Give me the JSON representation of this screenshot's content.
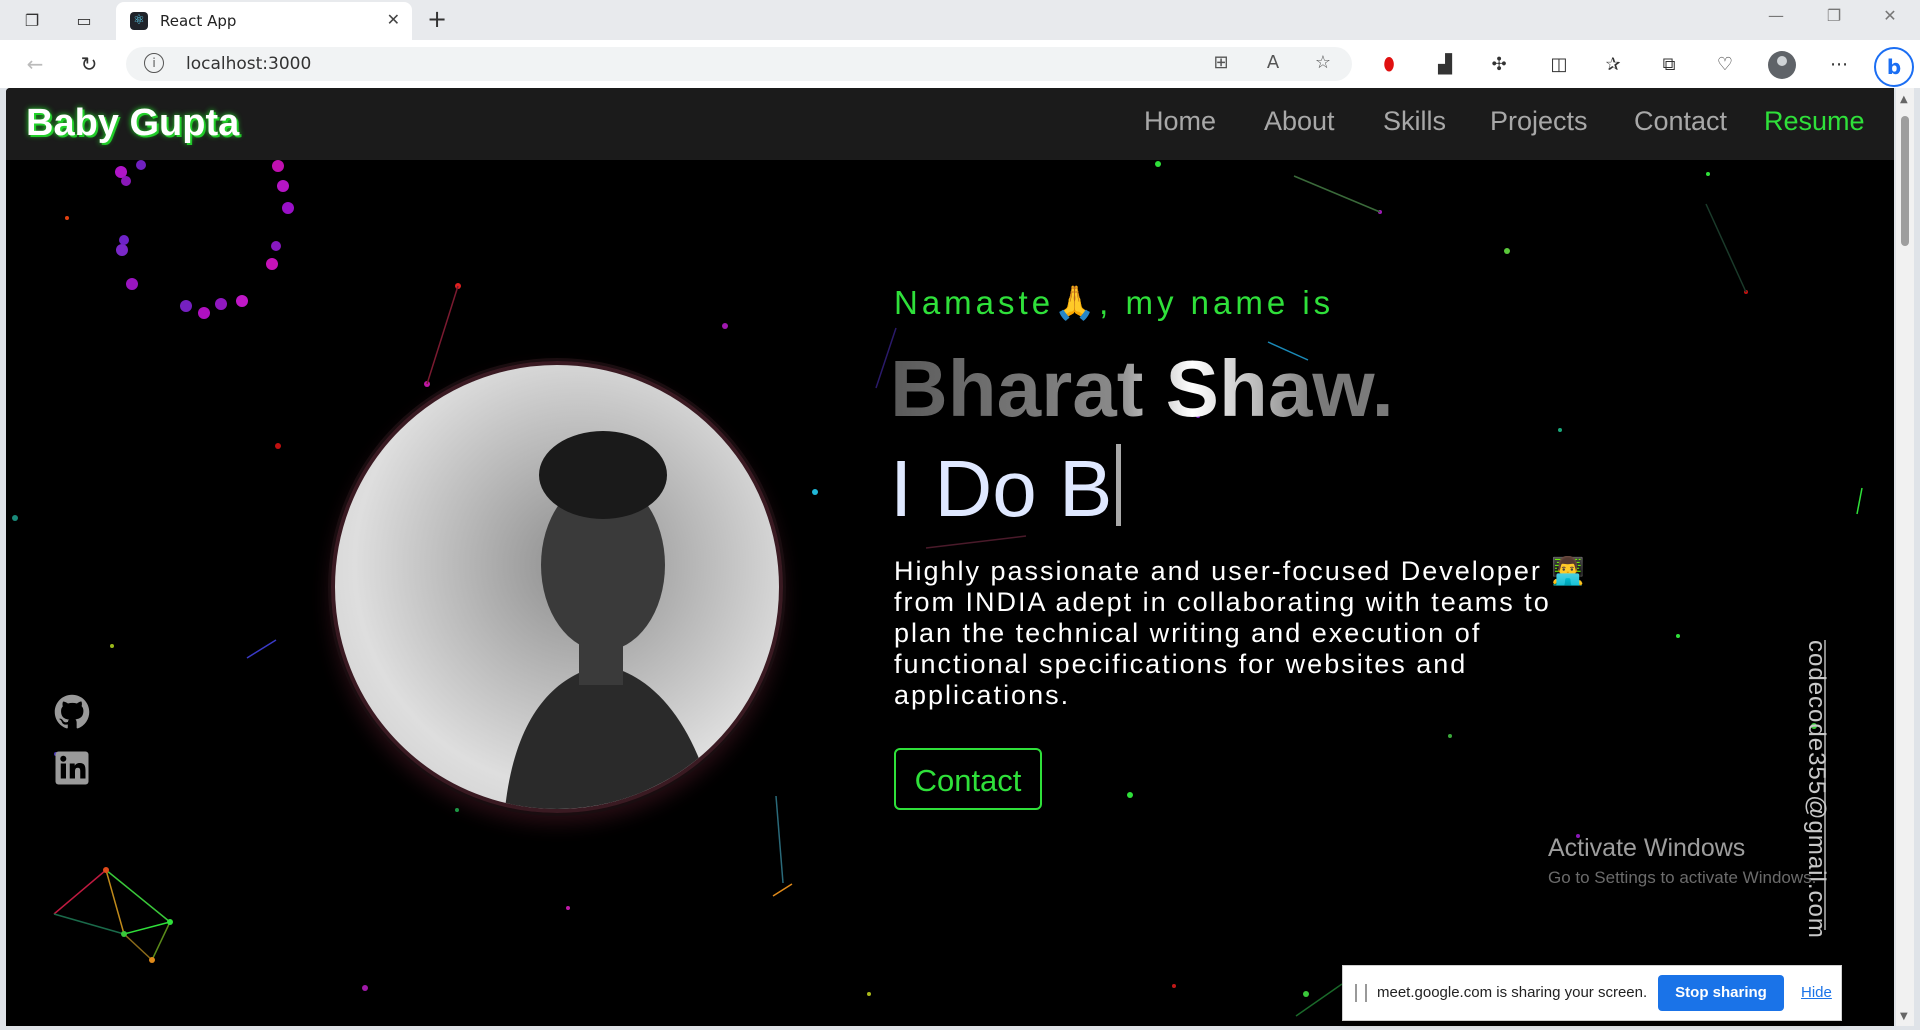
{
  "browser": {
    "tab_title": "React App",
    "url": "localhost:3000"
  },
  "site": {
    "brand": "Baby Gupta",
    "nav": [
      "Home",
      "About",
      "Skills",
      "Projects",
      "Contact",
      "Resume"
    ],
    "greeting": "Namaste🙏, my name is",
    "name": "Bharat Shaw.",
    "typing_text": "I Do B",
    "description": "Highly passionate and user-focused Developer 👨‍💻 from INDIA adept in collaborating with teams to plan the technical writing and execution of functional specifications for websites and applications.",
    "contact_button": "Contact",
    "email": "codecode355@gmail.com"
  },
  "os": {
    "watermark_title": "Activate Windows",
    "watermark_sub": "Go to Settings to activate Windows."
  },
  "share_bar": {
    "message": "meet.google.com is sharing your screen.",
    "stop_label": "Stop sharing",
    "hide_label": "Hide"
  },
  "colors": {
    "accent_green": "#2fe03a",
    "background": "#000000",
    "navbar": "#1b1b1b",
    "share_button": "#1a73e8"
  }
}
